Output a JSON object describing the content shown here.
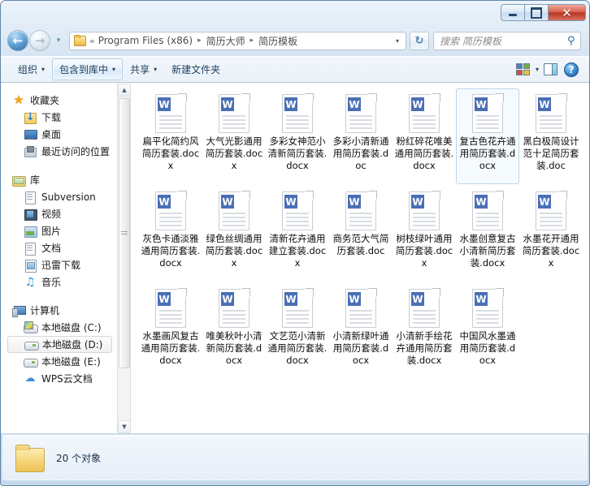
{
  "window": {
    "caption_buttons": {
      "minimize": "─",
      "maximize": "□",
      "close": "✕"
    }
  },
  "navbar": {
    "back_icon": "←",
    "forward_icon": "→",
    "history_icon": "▾",
    "folder_icon": "folder-icon",
    "ellipsis": "«",
    "breadcrumbs": [
      "Program Files (x86)",
      "简历大师",
      "简历模板"
    ],
    "separator": "▸",
    "dropdown_icon": "▾",
    "refresh_icon": "↻",
    "search": {
      "placeholder": "搜索 简历模板",
      "icon": "⚲"
    }
  },
  "toolbar": {
    "items": [
      {
        "label": "组织",
        "has_caret": true,
        "active": false
      },
      {
        "label": "包含到库中",
        "has_caret": true,
        "active": true
      },
      {
        "label": "共享",
        "has_caret": true,
        "active": false
      },
      {
        "label": "新建文件夹",
        "has_caret": false,
        "active": false
      }
    ],
    "caret": "▾",
    "view_mode_icon": "view-options-icon",
    "view_caret": "▾",
    "preview_pane_icon": "preview-pane-icon",
    "help_icon": "?"
  },
  "navpane": {
    "groups": [
      {
        "header": {
          "label": "收藏夹",
          "icon": "star-icon"
        },
        "items": [
          {
            "label": "下载",
            "icon": "download-icon"
          },
          {
            "label": "桌面",
            "icon": "desktop-icon"
          },
          {
            "label": "最近访问的位置",
            "icon": "recent-places-icon"
          }
        ]
      },
      {
        "header": {
          "label": "库",
          "icon": "library-icon"
        },
        "items": [
          {
            "label": "Subversion",
            "icon": "document-icon"
          },
          {
            "label": "视频",
            "icon": "video-icon"
          },
          {
            "label": "图片",
            "icon": "picture-icon"
          },
          {
            "label": "文档",
            "icon": "document-icon"
          },
          {
            "label": "迅雷下载",
            "icon": "xunlei-icon"
          },
          {
            "label": "音乐",
            "icon": "music-icon"
          }
        ]
      },
      {
        "header": {
          "label": "计算机",
          "icon": "computer-icon"
        },
        "items": [
          {
            "label": "本地磁盘 (C:)",
            "icon": "drive-c-icon",
            "selected": false
          },
          {
            "label": "本地磁盘 (D:)",
            "icon": "drive-icon",
            "selected": true
          },
          {
            "label": "本地磁盘 (E:)",
            "icon": "drive-icon",
            "selected": false
          },
          {
            "label": "WPS云文档",
            "icon": "cloud-icon",
            "selected": false
          }
        ]
      }
    ],
    "scrollbar": {
      "up_arrow": "▲",
      "down_arrow": "▼"
    }
  },
  "files": [
    {
      "name": "扁平化简约风简历套装.docx",
      "icon": "word-file-icon",
      "selected": false
    },
    {
      "name": "大气光影通用简历套装.docx",
      "icon": "word-file-icon",
      "selected": false
    },
    {
      "name": "多彩女神范小清新简历套装.docx",
      "icon": "word-file-icon",
      "selected": false
    },
    {
      "name": "多彩小清新通用简历套装.doc",
      "icon": "word-file-icon",
      "selected": false
    },
    {
      "name": "粉红碎花唯美通用简历套装.docx",
      "icon": "word-file-icon",
      "selected": false
    },
    {
      "name": "复古色花卉通用简历套装.docx",
      "icon": "word-file-icon",
      "selected": true
    },
    {
      "name": "黑白极简设计范十足简历套装.doc",
      "icon": "word-file-icon",
      "selected": false
    },
    {
      "name": "灰色卡通淡雅通用简历套装.docx",
      "icon": "word-file-icon",
      "selected": false
    },
    {
      "name": "绿色丝绸通用简历套装.docx",
      "icon": "word-file-icon",
      "selected": false
    },
    {
      "name": "清新花卉通用建立套装.docx",
      "icon": "word-file-icon",
      "selected": false
    },
    {
      "name": "商务范大气简历套装.doc",
      "icon": "word-file-icon",
      "selected": false
    },
    {
      "name": "树枝绿叶通用简历套装.docx",
      "icon": "word-file-icon",
      "selected": false
    },
    {
      "name": "水墨创意复古小清新简历套装.docx",
      "icon": "word-file-icon",
      "selected": false
    },
    {
      "name": "水墨花开通用简历套装.docx",
      "icon": "word-file-icon",
      "selected": false
    },
    {
      "name": "水墨画风复古通用简历套装.docx",
      "icon": "word-file-icon",
      "selected": false
    },
    {
      "name": "唯美秋叶小清新简历套装.docx",
      "icon": "word-file-icon",
      "selected": false
    },
    {
      "name": "文艺范小清新通用简历套装.docx",
      "icon": "word-file-icon",
      "selected": false
    },
    {
      "name": "小清新绿叶通用简历套装.docx",
      "icon": "word-file-icon",
      "selected": false
    },
    {
      "name": "小清新手绘花卉通用简历套装.docx",
      "icon": "word-file-icon",
      "selected": false
    },
    {
      "name": "中国风水墨通用简历套装.docx",
      "icon": "word-file-icon",
      "selected": false
    }
  ],
  "statusbar": {
    "folder_icon": "folder-icon",
    "text": "20 个对象"
  }
}
